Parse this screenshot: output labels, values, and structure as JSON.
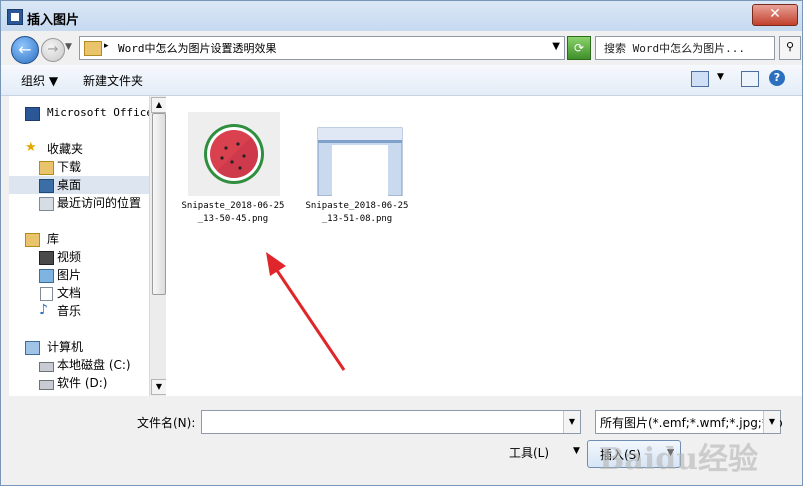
{
  "window": {
    "title": "插入图片"
  },
  "navigation": {
    "address_path": "Word中怎么为图片设置透明效果",
    "search_placeholder": "搜索 Word中怎么为图片..."
  },
  "toolbar": {
    "organize_label": "组织",
    "new_folder_label": "新建文件夹"
  },
  "sidebar": {
    "items": [
      {
        "label": "Microsoft Office",
        "icon": "word-icon",
        "level": 0
      },
      {
        "label": "收藏夹",
        "icon": "star-icon",
        "level": 0
      },
      {
        "label": "下载",
        "icon": "download-folder-icon",
        "level": 1
      },
      {
        "label": "桌面",
        "icon": "desktop-icon",
        "level": 1,
        "selected": true
      },
      {
        "label": "最近访问的位置",
        "icon": "recent-places-icon",
        "level": 1
      },
      {
        "label": "库",
        "icon": "library-icon",
        "level": 0
      },
      {
        "label": "视频",
        "icon": "video-icon",
        "level": 1
      },
      {
        "label": "图片",
        "icon": "pictures-icon",
        "level": 1
      },
      {
        "label": "文档",
        "icon": "documents-icon",
        "level": 1
      },
      {
        "label": "音乐",
        "icon": "music-icon",
        "level": 1
      },
      {
        "label": "计算机",
        "icon": "computer-icon",
        "level": 0
      },
      {
        "label": "本地磁盘 (C:)",
        "icon": "drive-icon",
        "level": 1
      },
      {
        "label": "软件 (D:)",
        "icon": "drive-icon",
        "level": 1
      }
    ]
  },
  "files": [
    {
      "name": "Snipaste_2018-06-25_13-50-45.png",
      "thumbnail": "watermelon-image"
    },
    {
      "name": "Snipaste_2018-06-25_13-51-08.png",
      "thumbnail": "word-screenshot-image"
    }
  ],
  "footer": {
    "filename_label": "文件名(N):",
    "filename_value": "",
    "filetype_value": "所有图片(*.emf;*.wmf;*.jpg;*.jp",
    "tools_label": "工具(L)",
    "insert_label": "插入(S)"
  },
  "watermark": "Baidu经验",
  "colors": {
    "selection": "#dde6f0",
    "arrow": "#e0262a",
    "watermelon_flesh": "#d9414f",
    "watermelon_rind": "#2f8f3f"
  }
}
